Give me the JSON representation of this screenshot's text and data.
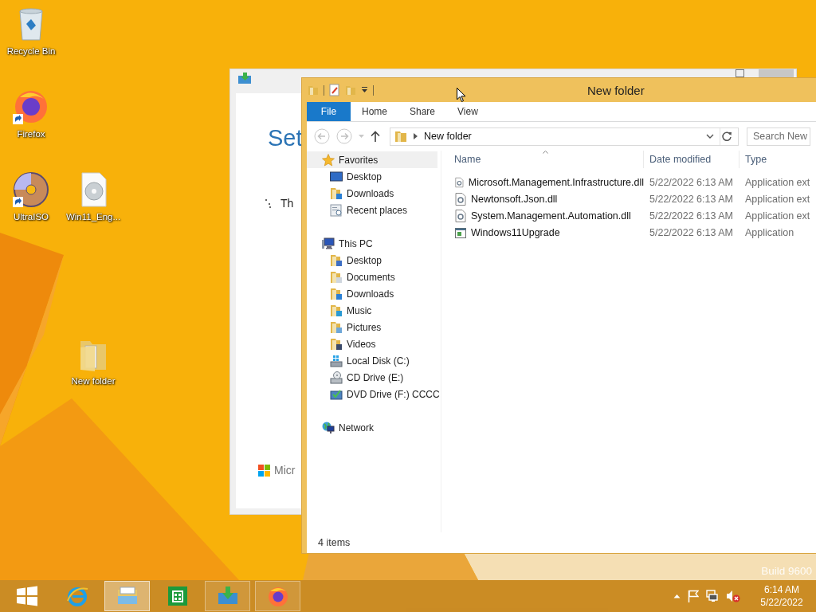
{
  "desktop": {
    "icons": [
      {
        "label": "Recycle Bin",
        "kind": "recycle",
        "shortcut": false
      },
      {
        "label": "Firefox",
        "kind": "firefox",
        "shortcut": true
      },
      {
        "label": "UltraISO",
        "kind": "disc",
        "shortcut": true
      },
      {
        "label": "Win11_Eng...",
        "kind": "iso",
        "shortcut": false
      },
      {
        "label": "New folder",
        "kind": "folder",
        "shortcut": false
      }
    ],
    "watermark": "Build 9600"
  },
  "setup_window": {
    "heading": "Set",
    "status": "Th",
    "brand": "Micr"
  },
  "explorer": {
    "title": "New folder",
    "ribbon_tabs": [
      {
        "label": "File",
        "kind": "menu"
      },
      {
        "label": "Home",
        "kind": "tab"
      },
      {
        "label": "Share",
        "kind": "tab"
      },
      {
        "label": "View",
        "kind": "tab"
      }
    ],
    "address": {
      "path": "New folder"
    },
    "search": {
      "placeholder": "Search New"
    },
    "navigation": [
      {
        "label": "Favorites",
        "kind": "star",
        "children": [
          {
            "label": "Desktop",
            "kind": "desktop"
          },
          {
            "label": "Downloads",
            "kind": "downloads"
          },
          {
            "label": "Recent places",
            "kind": "recent"
          }
        ]
      },
      {
        "label": "This PC",
        "kind": "pc",
        "children": [
          {
            "label": "Desktop",
            "kind": "folder-desktop"
          },
          {
            "label": "Documents",
            "kind": "documents"
          },
          {
            "label": "Downloads",
            "kind": "downloads"
          },
          {
            "label": "Music",
            "kind": "music"
          },
          {
            "label": "Pictures",
            "kind": "pictures"
          },
          {
            "label": "Videos",
            "kind": "videos"
          },
          {
            "label": "Local Disk (C:)",
            "kind": "disk"
          },
          {
            "label": "CD Drive (E:)",
            "kind": "cd"
          },
          {
            "label": "DVD Drive (F:) CCCC",
            "kind": "dvd"
          }
        ]
      },
      {
        "label": "Network",
        "kind": "network"
      }
    ],
    "columns": [
      {
        "label": "Name",
        "sorted": true
      },
      {
        "label": "Date modified",
        "sorted": false
      },
      {
        "label": "Type",
        "sorted": false
      }
    ],
    "files": [
      {
        "name": "Microsoft.Management.Infrastructure.dll",
        "date": "5/22/2022 6:13 AM",
        "type": "Application ext",
        "kind": "dll"
      },
      {
        "name": "Newtonsoft.Json.dll",
        "date": "5/22/2022 6:13 AM",
        "type": "Application ext",
        "kind": "dll"
      },
      {
        "name": "System.Management.Automation.dll",
        "date": "5/22/2022 6:13 AM",
        "type": "Application ext",
        "kind": "dll"
      },
      {
        "name": "Windows11Upgrade",
        "date": "5/22/2022 6:13 AM",
        "type": "Application",
        "kind": "exe"
      }
    ],
    "status_bar": "4 items"
  },
  "taskbar": {
    "items": [
      {
        "kind": "start",
        "running": false,
        "selected": false
      },
      {
        "kind": "browser",
        "running": false,
        "selected": false
      },
      {
        "kind": "explorer",
        "running": true,
        "selected": true
      },
      {
        "kind": "store",
        "running": false,
        "selected": false
      },
      {
        "kind": "setup",
        "running": true,
        "selected": false
      },
      {
        "kind": "firefox",
        "running": true,
        "selected": false
      }
    ],
    "volume_muted": true,
    "clock": {
      "time": "6:14 AM",
      "date": "5/22/2022"
    }
  }
}
